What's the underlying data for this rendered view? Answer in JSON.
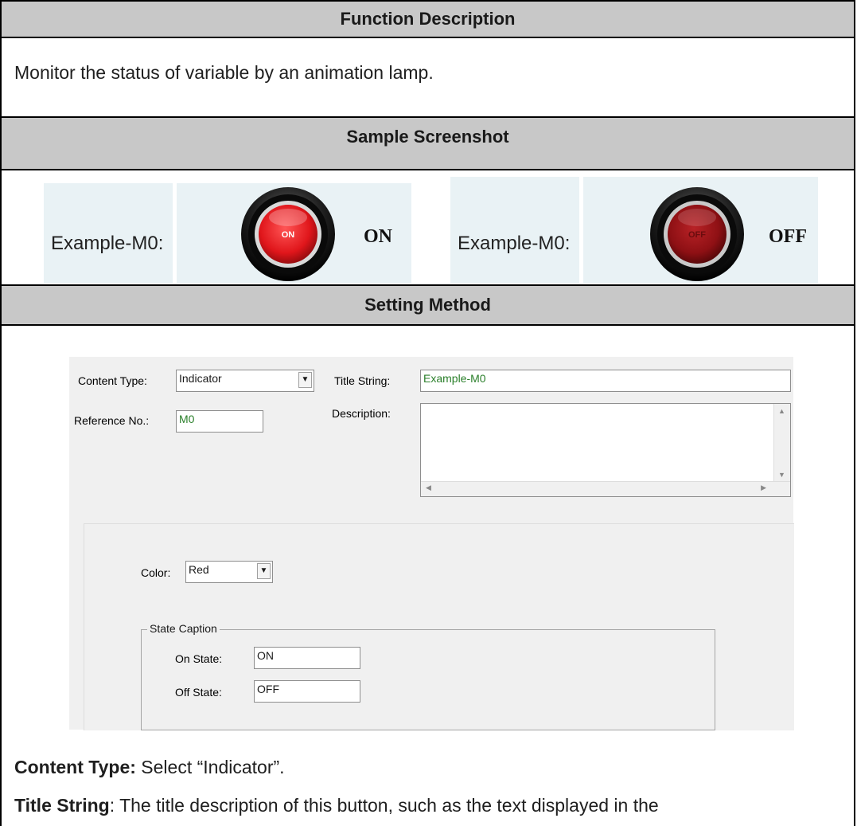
{
  "sections": {
    "function_header": "Function Description",
    "function_text": "Monitor the status of variable by an animation lamp.",
    "sample_header": "Sample Screenshot",
    "setting_header": "Setting Method"
  },
  "sample": {
    "on": {
      "label": "Example-M0:",
      "lamp_text": "ON",
      "state_text": "ON"
    },
    "off": {
      "label": "Example-M0:",
      "lamp_text": "OFF",
      "state_text": "OFF"
    }
  },
  "form": {
    "content_type_label": "Content Type:",
    "content_type_value": "Indicator",
    "title_string_label": "Title String:",
    "title_string_value": "Example-M0",
    "reference_label": "Reference No.:",
    "reference_value": "M0",
    "description_label": "Description:",
    "color_label": "Color:",
    "color_value": "Red",
    "state_caption_legend": "State Caption",
    "on_state_label": "On State:",
    "on_state_value": "ON",
    "off_state_label": "Off State:",
    "off_state_value": "OFF"
  },
  "notes": {
    "content_type_term": "Content Type:",
    "content_type_text": " Select “Indicator”.",
    "title_string_term": "Title String",
    "title_string_text": ": The title description of this button, such as the text displayed in the"
  },
  "colors": {
    "header_bg": "#c8c8c8",
    "cell_bg": "#e9f2f5",
    "lamp_red": "#e0161b",
    "text_green": "#2a7f2a"
  }
}
